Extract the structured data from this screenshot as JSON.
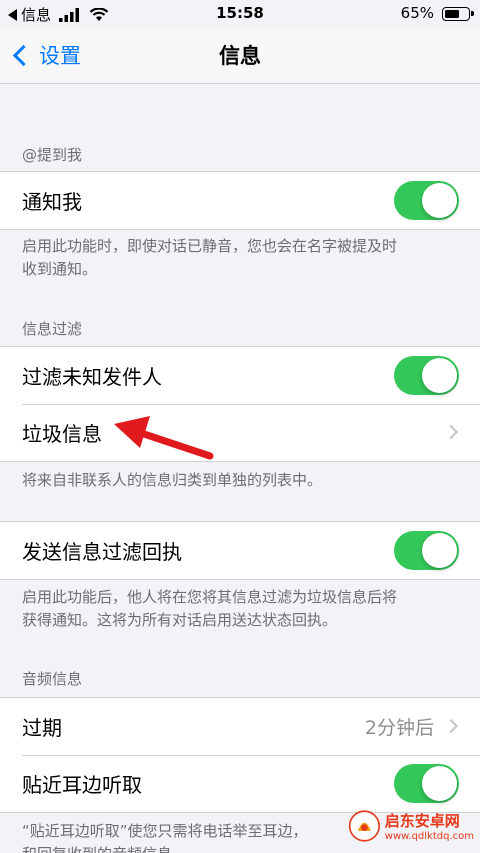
{
  "status_bar": {
    "back_app": "信息",
    "time": "15:58",
    "battery_percent": "65%",
    "battery_level": 0.65
  },
  "nav": {
    "back_label": "设置",
    "title": "信息"
  },
  "mentions": {
    "header": "@提到我",
    "notify_me": {
      "label": "通知我",
      "on": true
    },
    "footer_lines": [
      "启用此功能时，即使对话已静音，您也会在名字被提及时",
      "收到通知。"
    ]
  },
  "filtering": {
    "header": "信息过滤",
    "filter_unknown": {
      "label": "过滤未知发件人",
      "on": true
    },
    "junk": {
      "label": "垃圾信息"
    },
    "footer": "将来自非联系人的信息归类到单独的列表中。"
  },
  "send_receipt": {
    "label": "发送信息过滤回执",
    "on": true,
    "footer_lines": [
      "启用此功能后，他人将在您将其信息过滤为垃圾信息后将",
      "获得通知。这将为所有对话启用送达状态回执。"
    ]
  },
  "audio": {
    "header": "音频信息",
    "expire": {
      "label": "过期",
      "value": "2分钟后"
    },
    "raise_to_listen": {
      "label": "贴近耳边听取",
      "on": true
    },
    "footer_lines": [
      "“贴近耳边听取”使您只需将电话举至耳边，",
      "和回复收到的音频信息"
    ]
  },
  "colors": {
    "toggle_on": "#34c759",
    "link": "#007aff",
    "arrow": "#e0191c"
  },
  "watermark": {
    "name": "启东安卓网",
    "url": "www.qdlktdq.com"
  }
}
